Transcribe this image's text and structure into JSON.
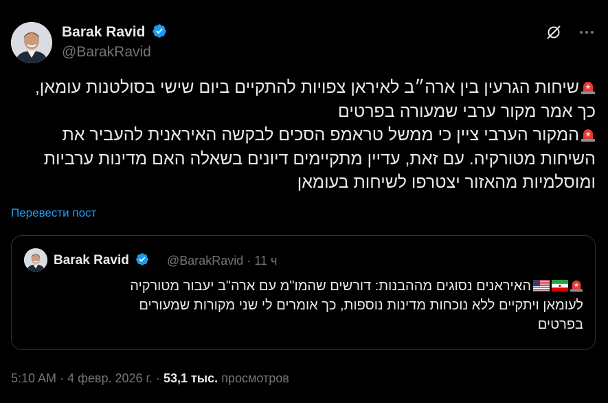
{
  "author": {
    "name": "Barak Ravid",
    "handle": "@BarakRavid"
  },
  "post": {
    "paragraph1_line1": "שיחות הגרעין בין ארה״ב לאיראן צפויות להתקיים ביום שישי בסולטנות עומאן,",
    "paragraph1_line2": "כך אמר מקור ערבי שמעורה בפרטים",
    "paragraph2_line1": "המקור הערבי ציין כי ממשל טראמפ הסכים לבקשה האיראנית להעביר את",
    "paragraph2_line2": "השיחות מטורקיה. עם זאת, עדיין מתקיימים דיונים בשאלה האם מדינות ערביות",
    "paragraph2_line3": "ומוסלמיות מהאזור יצטרפו לשיחות בעומאן",
    "translate_label": "Перевести пост"
  },
  "quote": {
    "name": "Barak Ravid",
    "handle": "@BarakRavid",
    "separator": "·",
    "time": "11 ч",
    "line1": "האיראנים נסוגים מההבנות: דורשים שהמו\"מ עם ארה\"ב יעבור מטורקיה",
    "line2": "לעומאן ויתקיים ללא נוכחות מדינות נוספות, כך אומרים לי שני מקורות שמעורים",
    "line3": "בפרטים"
  },
  "footer": {
    "time": "5:10 AM",
    "separator1": "·",
    "date": "4 февр. 2026 г.",
    "separator2": "·",
    "views_count": "53,1 тыс.",
    "views_label": "просмотров"
  },
  "icons": {
    "grok": "grok-icon",
    "more": "more-icon",
    "verified": "verified-badge-icon",
    "siren": "siren-emoji",
    "flag_us": "us-flag-emoji",
    "flag_iran": "iran-flag-emoji"
  },
  "colors": {
    "background": "#000000",
    "text": "#e7e9ea",
    "secondary": "#71767b",
    "link": "#1d9bf0",
    "border": "#2f3336",
    "verified": "#1d9bf0"
  }
}
